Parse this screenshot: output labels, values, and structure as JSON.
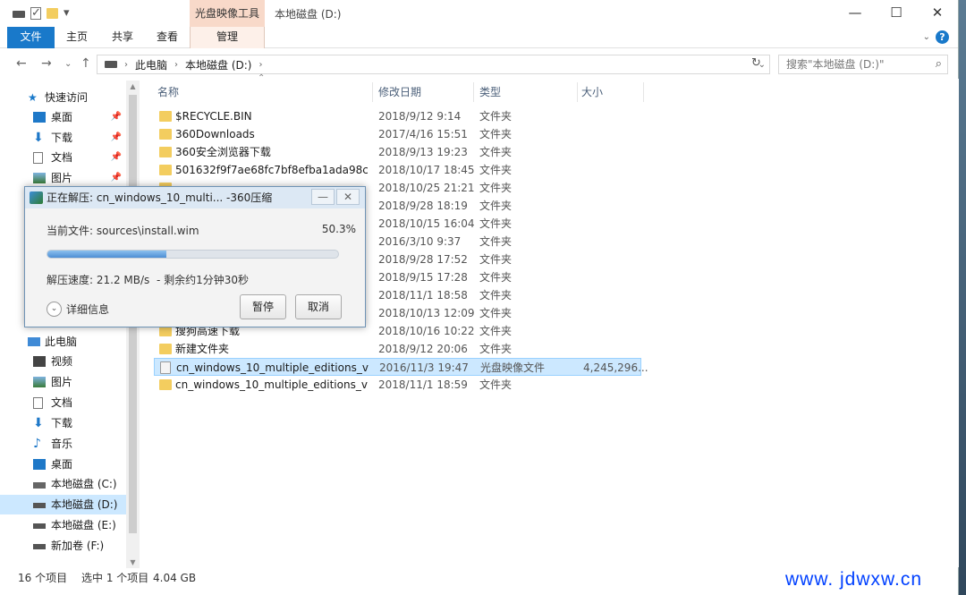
{
  "window": {
    "title": "本地磁盘 (D:)",
    "ribbon_context_group": "光盘映像工具",
    "controls": {
      "minimize": "—",
      "maximize": "☐",
      "close": "✕"
    }
  },
  "ribbon": {
    "tabs": [
      {
        "label": "文件"
      },
      {
        "label": "主页"
      },
      {
        "label": "共享"
      },
      {
        "label": "查看"
      },
      {
        "label": "管理"
      }
    ]
  },
  "address": {
    "path": [
      "此电脑",
      "本地磁盘 (D:)"
    ],
    "search_placeholder": "搜索\"本地磁盘 (D:)\""
  },
  "nav": {
    "quick_access": "快速访问",
    "quick_items": [
      {
        "label": "桌面"
      },
      {
        "label": "下载"
      },
      {
        "label": "文档"
      },
      {
        "label": "图片"
      }
    ],
    "this_pc": "此电脑",
    "pc_items": [
      {
        "label": "视频"
      },
      {
        "label": "图片"
      },
      {
        "label": "文档"
      },
      {
        "label": "下载"
      },
      {
        "label": "音乐"
      },
      {
        "label": "桌面"
      },
      {
        "label": "本地磁盘 (C:)"
      },
      {
        "label": "本地磁盘 (D:)"
      },
      {
        "label": "本地磁盘 (E:)"
      },
      {
        "label": "新加卷 (F:)"
      }
    ]
  },
  "columns": {
    "name": "名称",
    "date": "修改日期",
    "type": "类型",
    "size": "大小"
  },
  "files": [
    {
      "name": "$RECYCLE.BIN",
      "date": "2018/9/12 9:14",
      "type": "文件夹",
      "size": ""
    },
    {
      "name": "360Downloads",
      "date": "2017/4/16 15:51",
      "type": "文件夹",
      "size": ""
    },
    {
      "name": "360安全浏览器下载",
      "date": "2018/9/13 19:23",
      "type": "文件夹",
      "size": ""
    },
    {
      "name": "501632f9f7ae68fc7bf8efba1ada98c5",
      "date": "2018/10/17 18:45",
      "type": "文件夹",
      "size": ""
    },
    {
      "name": "",
      "date": "2018/10/25 21:21",
      "type": "文件夹",
      "size": ""
    },
    {
      "name": "",
      "date": "2018/9/28 18:19",
      "type": "文件夹",
      "size": ""
    },
    {
      "name": "",
      "date": "2018/10/15 16:04",
      "type": "文件夹",
      "size": ""
    },
    {
      "name": "",
      "date": "2016/3/10 9:37",
      "type": "文件夹",
      "size": ""
    },
    {
      "name": "",
      "date": "2018/9/28 17:52",
      "type": "文件夹",
      "size": ""
    },
    {
      "name": "",
      "date": "2018/9/15 17:28",
      "type": "文件夹",
      "size": ""
    },
    {
      "name": "",
      "date": "2018/11/1 18:58",
      "type": "文件夹",
      "size": ""
    },
    {
      "name": "",
      "date": "2018/10/13 12:09",
      "type": "文件夹",
      "size": ""
    },
    {
      "name": "搜狗高速下载",
      "date": "2018/10/16 10:22",
      "type": "文件夹",
      "size": ""
    },
    {
      "name": "新建文件夹",
      "date": "2018/9/12 20:06",
      "type": "文件夹",
      "size": ""
    },
    {
      "name": "cn_windows_10_multiple_editions_ver...",
      "date": "2016/11/3 19:47",
      "type": "光盘映像文件",
      "size": "4,245,296...",
      "selected": true,
      "icon": "iso"
    },
    {
      "name": "cn_windows_10_multiple_editions_ver...",
      "date": "2018/11/1 18:59",
      "type": "文件夹",
      "size": ""
    }
  ],
  "status": {
    "count": "16 个项目",
    "selection": "选中 1 个项目",
    "size": "4.04 GB"
  },
  "watermark": "www. jdwxw.cn",
  "dialog": {
    "title": "正在解压: cn_windows_10_multi... -360压缩",
    "current_file_label": "当前文件: sources\\install.wim",
    "percent": "50.3%",
    "progress_fraction": 0.41,
    "speed": "解压速度: 21.2 MB/s",
    "remaining": "- 剩余约1分钟30秒",
    "details": "详细信息",
    "pause": "暂停",
    "cancel": "取消",
    "title_buttons": {
      "minimize": "—",
      "close": "✕"
    }
  }
}
